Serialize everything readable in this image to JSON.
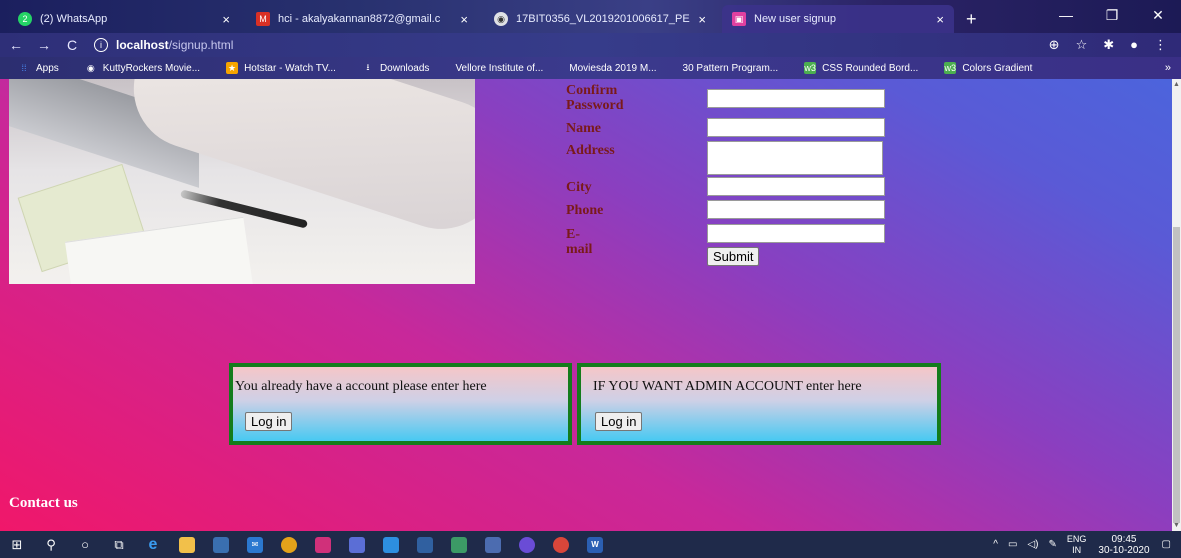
{
  "browser": {
    "tabs": [
      {
        "title": "(2) WhatsApp",
        "color": "#25d366",
        "badge": "2"
      },
      {
        "title": "hci - akalyakannan8872@gmail.c",
        "color": "#d93025",
        "badge": "M"
      },
      {
        "title": "17BIT0356_VL2019201006617_PE",
        "color": "#5f6368",
        "badge": ""
      },
      {
        "title": "New user signup",
        "color": "#e040a0",
        "badge": ""
      }
    ],
    "new_tab": "+",
    "address": {
      "host": "localhost",
      "path": "/signup.html"
    },
    "bookmarks": [
      {
        "label": "Apps",
        "icon": "apps-icon",
        "color": "#4a8af4"
      },
      {
        "label": "KuttyRockers Movie...",
        "icon": "globe-icon",
        "color": "#ffffff"
      },
      {
        "label": "Hotstar - Watch TV...",
        "icon": "hotstar-icon",
        "color": "#f6a400"
      },
      {
        "label": "Downloads",
        "icon": "download-icon",
        "color": "#ffffff"
      },
      {
        "label": "Vellore Institute of...",
        "icon": "",
        "color": ""
      },
      {
        "label": "Moviesda 2019 M...",
        "icon": "",
        "color": ""
      },
      {
        "label": "30 Pattern Program...",
        "icon": "",
        "color": ""
      },
      {
        "label": "CSS Rounded Bord...",
        "icon": "w3-icon",
        "color": "#4caf50"
      },
      {
        "label": "Colors Gradient",
        "icon": "w3-icon",
        "color": "#4caf50"
      }
    ],
    "more": "»"
  },
  "form": {
    "confirm_password_label": "Confirm Password",
    "name_label": "Name",
    "address_label": "Address",
    "city_label": "City",
    "phone_label": "Phone",
    "email_label": "E-mail",
    "submit_label": "Submit"
  },
  "login_boxes": [
    {
      "text": "You already have a account please enter here",
      "button": "Log in"
    },
    {
      "text": "IF YOU WANT ADMIN ACCOUNT enter here",
      "button": "Log in"
    }
  ],
  "footer": {
    "contact": "Contact us"
  },
  "taskbar": {
    "language": "ENG",
    "region": "IN",
    "time": "09:45",
    "date": "30-10-2020"
  }
}
